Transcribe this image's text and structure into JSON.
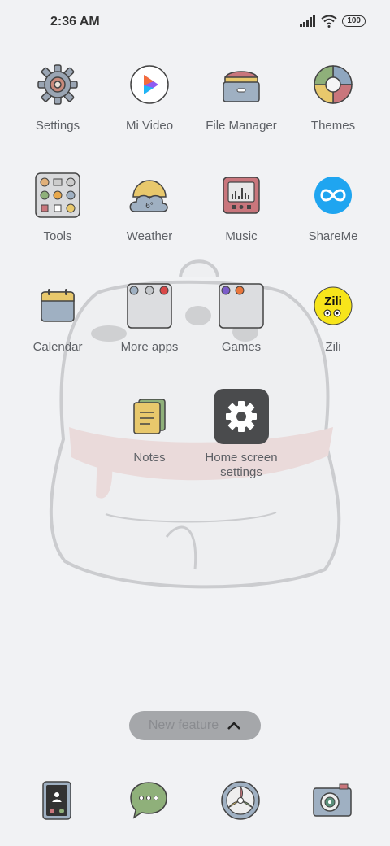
{
  "status": {
    "time": "2:36 AM",
    "battery": "100"
  },
  "apps": {
    "settings": "Settings",
    "mi_video": "Mi Video",
    "file_manager": "File Manager",
    "themes": "Themes",
    "tools": "Tools",
    "weather": "Weather",
    "weather_temp": "6°",
    "music": "Music",
    "shareme": "ShareMe",
    "calendar": "Calendar",
    "more_apps": "More apps",
    "games": "Games",
    "zili": "Zili",
    "zili_logo": "Zili",
    "notes": "Notes",
    "home_screen_settings": "Home screen settings"
  },
  "pill": {
    "label": "New feature"
  },
  "dock": [
    "phone-icon",
    "messages-icon",
    "browser-icon",
    "camera-icon"
  ],
  "colors": {
    "background": "#f1f2f4",
    "label": "#5e6166",
    "pill": "#a5a7aa"
  }
}
